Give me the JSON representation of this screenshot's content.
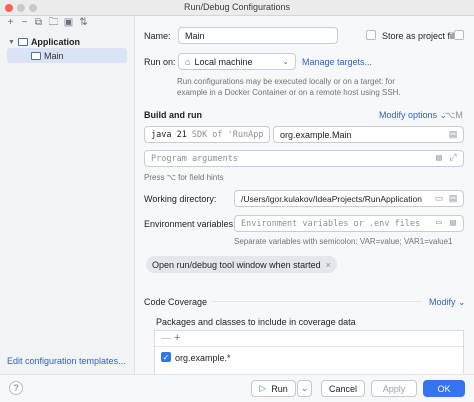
{
  "window": {
    "title": "Run/Debug Configurations"
  },
  "toolbar": {
    "add": "+",
    "remove": "−",
    "copy": "⧉",
    "save": "🗀",
    "folder": "▣",
    "sort": "⇅"
  },
  "tree": {
    "group_label": "Application",
    "item_label": "Main"
  },
  "left_footer": {
    "edit_templates": "Edit configuration templates..."
  },
  "form": {
    "name_label": "Name:",
    "name_value": "Main",
    "store_label": "Store as project file",
    "run_on_label": "Run on:",
    "run_on_value": "Local machine",
    "manage_targets": "Manage targets...",
    "run_on_hint": "Run configurations may be executed locally or on a target: for example in a Docker Container or on a remote host using SSH.",
    "build_and_run": "Build and run",
    "modify_options": "Modify options",
    "modify_shortcut": "⌥M",
    "sdk_value": "java 21",
    "sdk_hint": "SDK of 'RunApp",
    "main_class": "org.example.Main",
    "program_args_placeholder": "Program arguments",
    "field_hints": "Press ⌥ for field hints",
    "working_dir_label": "Working directory:",
    "working_dir_value": "/Users/igor.kulakov/IdeaProjects/RunApplication",
    "env_label": "Environment variables:",
    "env_placeholder": "Environment variables or .env files",
    "env_hint": "Separate variables with semicolon: VAR=value; VAR1=value1",
    "open_tool_window": "Open run/debug tool window when started",
    "code_coverage": "Code Coverage",
    "modify": "Modify",
    "coverage_label": "Packages and classes to include in coverage data",
    "coverage_item": "org.example.*"
  },
  "buttons": {
    "help": "?",
    "run": "Run",
    "cancel": "Cancel",
    "apply": "Apply",
    "ok": "OK"
  },
  "colors": {
    "accent": "#3574f0",
    "link": "#2e62c9",
    "selection": "#dbe4f6"
  }
}
